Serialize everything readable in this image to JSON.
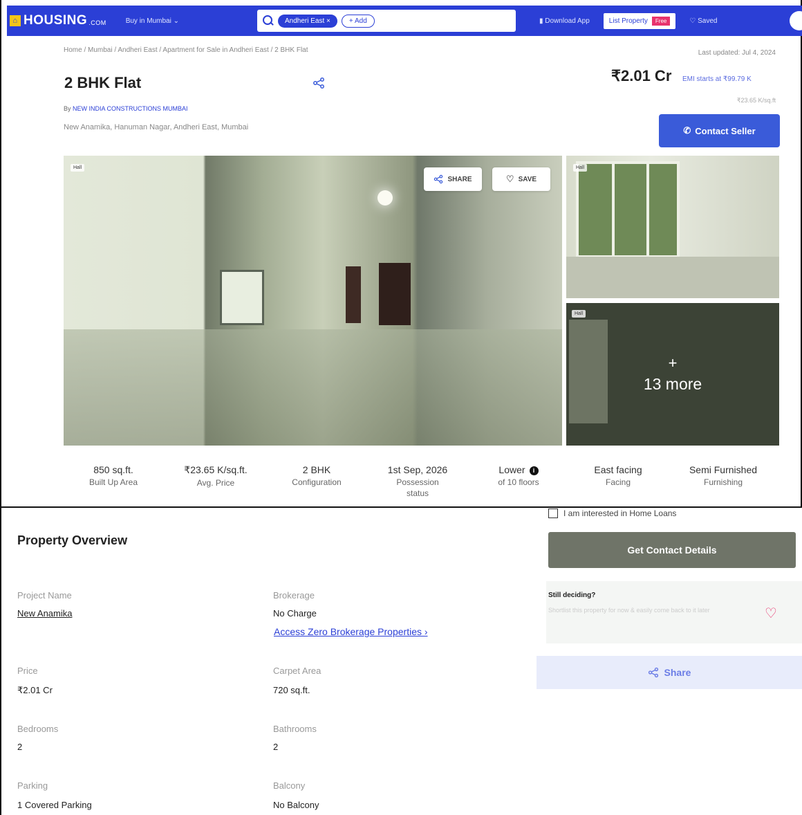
{
  "navbar": {
    "brand": "HOUSING",
    "brand_suffix": ".COM",
    "city_select": "Buy in Mumbai",
    "search_chip": "Andheri East",
    "add_chip": "+ Add",
    "download_app": "Download App",
    "list_property": "List Property",
    "free_badge": "Free",
    "saved": "Saved"
  },
  "breadcrumb": "Home / Mumbai / Andheri East / Apartment for Sale in Andheri East / 2 BHK Flat",
  "last_updated": "Last updated: Jul 4, 2024",
  "listing": {
    "title": "2 BHK Flat",
    "price": "₹2.01 Cr",
    "emi": "EMI starts at ₹99.79 K",
    "price_per_sqft": "₹23.65 K/sq.ft",
    "developer_prefix": "By",
    "developer": "NEW INDIA CONSTRUCTIONS MUMBAI",
    "address": "New Anamika, Hanuman Nagar, Andheri East, Mumbai",
    "contact_button": "Contact Seller"
  },
  "gallery": {
    "main_tag": "Hall",
    "thumb1_tag": "Hall",
    "thumb2_tag": "Hall",
    "share_button": "SHARE",
    "save_button": "SAVE",
    "more_plus": "+",
    "more_text": "13 more"
  },
  "stats": [
    {
      "value": "850 sq.ft.",
      "label": "Built Up Area"
    },
    {
      "value": "₹23.65 K/sq.ft.",
      "label": "Avg. Price"
    },
    {
      "value": "2 BHK",
      "label": "Configuration"
    },
    {
      "value": "1st Sep, 2026",
      "label": "Possession status"
    },
    {
      "value": "Lower",
      "label": "of 10 floors"
    },
    {
      "value": "East facing",
      "label": "Facing"
    },
    {
      "value": "Semi Furnished",
      "label": "Furnishing"
    }
  ],
  "overview": {
    "title": "Property Overview",
    "project_name_label": "Project Name",
    "project_name_value": "New Anamika",
    "brokerage_label": "Brokerage",
    "brokerage_value": "No Charge",
    "zero_brokerage_link": "Access Zero Brokerage Properties ›",
    "price_label": "Price",
    "price_value": "₹2.01 Cr",
    "carpet_area_label": "Carpet Area",
    "carpet_area_value": "720 sq.ft.",
    "bedrooms_label": "Bedrooms",
    "bedrooms_value": "2",
    "bathrooms_label": "Bathrooms",
    "bathrooms_value": "2",
    "parking_label": "Parking",
    "parking_value": "1 Covered Parking",
    "balcony_label": "Balcony",
    "balcony_value": "No Balcony"
  },
  "sidebar": {
    "home_loan_checkbox": "I am interested in Home Loans",
    "get_contact_button": "Get Contact Details",
    "still_deciding_title": "Still deciding?",
    "still_deciding_sub": "Shortlist this property for now & easily come back to it later",
    "share_button": "Share"
  },
  "colors": {
    "brand_blue": "#2b3fd6",
    "contact_button": "#3a5bd9",
    "heart_pink": "#e8336e",
    "get_contact_bg": "#6f7468"
  },
  "icons": [
    "search-icon",
    "share-icon",
    "heart-icon",
    "phone-icon",
    "info-icon",
    "menu-icon"
  ]
}
